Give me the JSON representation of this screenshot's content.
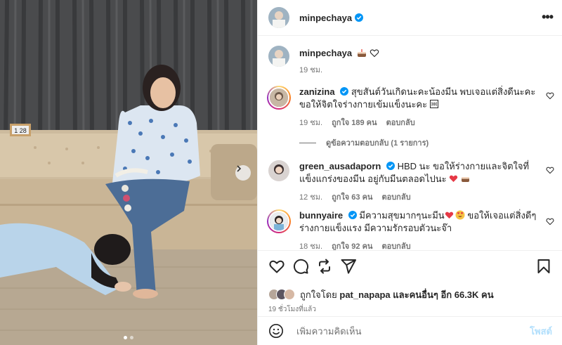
{
  "post": {
    "author": "minpechaya",
    "caption": {
      "username": "minpechaya",
      "icons": [
        "cake-emoji",
        "heart-outline-emoji"
      ],
      "time": "19 ชม."
    },
    "photo": {
      "calendar_text": "1 28"
    }
  },
  "comments": [
    {
      "username": "zanizina",
      "verified": true,
      "text": "สุขสันต์วันเกิดนะคะน้องมีน พบเจอแต่สิ่งดีนะคะ ขอให้จิตใจร่างกายเข้มแข็งนะคะ",
      "time": "19 ชม.",
      "likes": "ถูกใจ 189 คน",
      "reply": "ตอบกลับ",
      "view_replies": "ดูข้อความตอบกลับ (1 รายการ)"
    },
    {
      "username": "green_ausadaporn",
      "verified": true,
      "text": "HBD นะ ขอให้ร่างกายและจิตใจที่แข็งแกร่งของมีน อยู่กับมีนตลอดไปนะ",
      "time": "12 ชม.",
      "likes": "ถูกใจ 63 คน",
      "reply": "ตอบกลับ"
    },
    {
      "username": "bunnyaire",
      "verified": true,
      "text_a": "มีความสุขมากๆนะมีน",
      "text_b": "ขอให้เจอแต่สิ่งดีๆ ร่างกายแข็งแรง มีความรักรอบตัวนะจ๊า",
      "time": "18 ชม.",
      "likes": "ถูกใจ 92 คน",
      "reply": "ตอบกลับ"
    }
  ],
  "engagement": {
    "liked_by_prefix": "ถูกใจโดย",
    "liked_by_user": "pat_napapa",
    "liked_by_suffix": "และคนอื่นๆ อีก 66.3K คน",
    "posted_ago": "19 ชั่วโมงที่แล้ว"
  },
  "composer": {
    "placeholder": "เพิ่มความคิดเห็น",
    "post_label": "โพสต์"
  },
  "colors": {
    "verified_blue": "#0095f6",
    "heart_red": "#ed4956",
    "post_disabled": "#b2dffc",
    "muted": "#737373"
  },
  "icons": [
    "more-icon",
    "heart-icon",
    "comment-icon",
    "repost-icon",
    "share-icon",
    "save-icon",
    "emoji-icon",
    "next-arrow-icon"
  ]
}
